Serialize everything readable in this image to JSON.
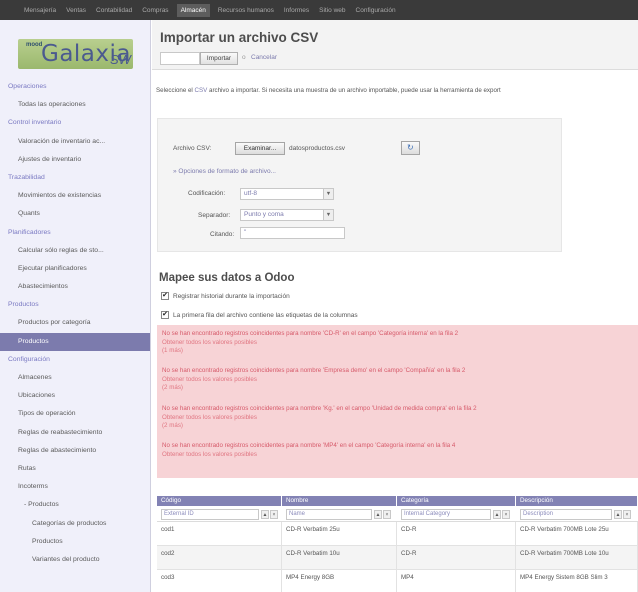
{
  "topbar": {
    "items": [
      "Mensajería",
      "Ventas",
      "Contabilidad",
      "Compras",
      "Almacén",
      "Recursos humanos",
      "Informes",
      "Sitio web",
      "Configuración"
    ],
    "active_index": 4
  },
  "logo": {
    "top": "mood",
    "main": "Galaxia",
    "suffix": "SW"
  },
  "sidebar": {
    "rows": [
      {
        "kind": "section",
        "label": "Operaciones"
      },
      {
        "kind": "item",
        "label": "Todas las operaciones"
      },
      {
        "kind": "section",
        "label": "Control inventario"
      },
      {
        "kind": "item",
        "label": "Valoración de inventario ac..."
      },
      {
        "kind": "item",
        "label": "Ajustes de inventario"
      },
      {
        "kind": "section",
        "label": "Trazabilidad"
      },
      {
        "kind": "item",
        "label": "Movimientos de existencias"
      },
      {
        "kind": "item",
        "label": "Quants"
      },
      {
        "kind": "section",
        "label": "Planificadores"
      },
      {
        "kind": "item",
        "label": "Calcular sólo reglas de sto..."
      },
      {
        "kind": "item",
        "label": "Ejecutar planificadores"
      },
      {
        "kind": "item",
        "label": "Abastecimientos"
      },
      {
        "kind": "section",
        "label": "Productos"
      },
      {
        "kind": "item",
        "label": "Productos por categoría"
      },
      {
        "kind": "item",
        "label": "Productos",
        "active": true
      },
      {
        "kind": "section",
        "label": "Configuración"
      },
      {
        "kind": "item",
        "label": "Almacenes"
      },
      {
        "kind": "item",
        "label": "Ubicaciones"
      },
      {
        "kind": "item",
        "label": "Tipos de operación"
      },
      {
        "kind": "item",
        "label": "Reglas de reabastecimiento"
      },
      {
        "kind": "item",
        "label": "Reglas de abastecimiento"
      },
      {
        "kind": "item",
        "label": "Rutas"
      },
      {
        "kind": "item",
        "label": "Incoterms"
      },
      {
        "kind": "sub",
        "label": "- Productos"
      },
      {
        "kind": "sub2",
        "label": "Categorías de productos"
      },
      {
        "kind": "sub2",
        "label": "Productos"
      },
      {
        "kind": "sub2",
        "label": "Variantes del producto"
      }
    ]
  },
  "header": {
    "title": "Importar un archivo CSV",
    "import_label": "Importar",
    "or_label": "o",
    "cancel_label": "Cancelar"
  },
  "intro": {
    "before": "Seleccione el",
    "link": "CSV",
    "after": "archivo a importar. Si necesita una muestra de un archivo importable, puede usar la herramienta de export"
  },
  "file_form": {
    "file_label": "Archivo CSV:",
    "browse_label": "Examinar...",
    "file_name": "datosproductos.csv",
    "options_link": "» Opciones de formato de archivo...",
    "encoding_label": "Codificación:",
    "encoding_value": "utf-8",
    "separator_label": "Separador:",
    "separator_value": "Punto y coma",
    "quote_label": "Citando:",
    "quote_value": "\""
  },
  "mapping": {
    "title": "Mapee sus datos a Odoo",
    "track_history_label": "Registrar historial durante la importación",
    "track_history_checked": true,
    "header_row_label": "La primera fila del archivo contiene las etiquetas de la columnas",
    "header_row_checked": true
  },
  "errors": [
    {
      "message": "No se han encontrado registros coincidentes para nombre 'CD-R' en el campo 'Categoría interna' en la fila 2",
      "link": "Obtener todos los valores posibles",
      "more": "(1 más)"
    },
    {
      "message": "No se han encontrado registros coincidentes para nombre 'Empresa demo' en el campo 'Compañía' en la fila 2",
      "link": "Obtener todos los valores posibles",
      "more": "(2 más)"
    },
    {
      "message": "No se han encontrado registros coincidentes para nombre 'Kg.' en el campo 'Unidad de medida compra' en la fila 2",
      "link": "Obtener todos los valores posibles",
      "more": "(2 más)"
    },
    {
      "message": "No se han encontrado registros coincidentes para nombre 'MP4' en el campo 'Categoría interna' en la fila 4",
      "link": "Obtener todos los valores posibles",
      "more": ""
    }
  ],
  "grid": {
    "headers": [
      "Código",
      "Nombre",
      "Categoría",
      "Descripción"
    ],
    "filters": [
      "External ID",
      "Name",
      "Internal Category",
      "Description"
    ],
    "rows": [
      [
        "cod1",
        "CD-R Verbatim 25u",
        "CD-R",
        "CD-R Verbatim 700MB Lote 25u"
      ],
      [
        "cod2",
        "CD-R Verbatim 10u",
        "CD-R",
        "CD-R Verbatim 700MB Lote 10u"
      ],
      [
        "cod3",
        "MP4 Energy 8GB",
        "MP4",
        "MP4 Energy Sistem 8GB Slim 3"
      ]
    ]
  }
}
